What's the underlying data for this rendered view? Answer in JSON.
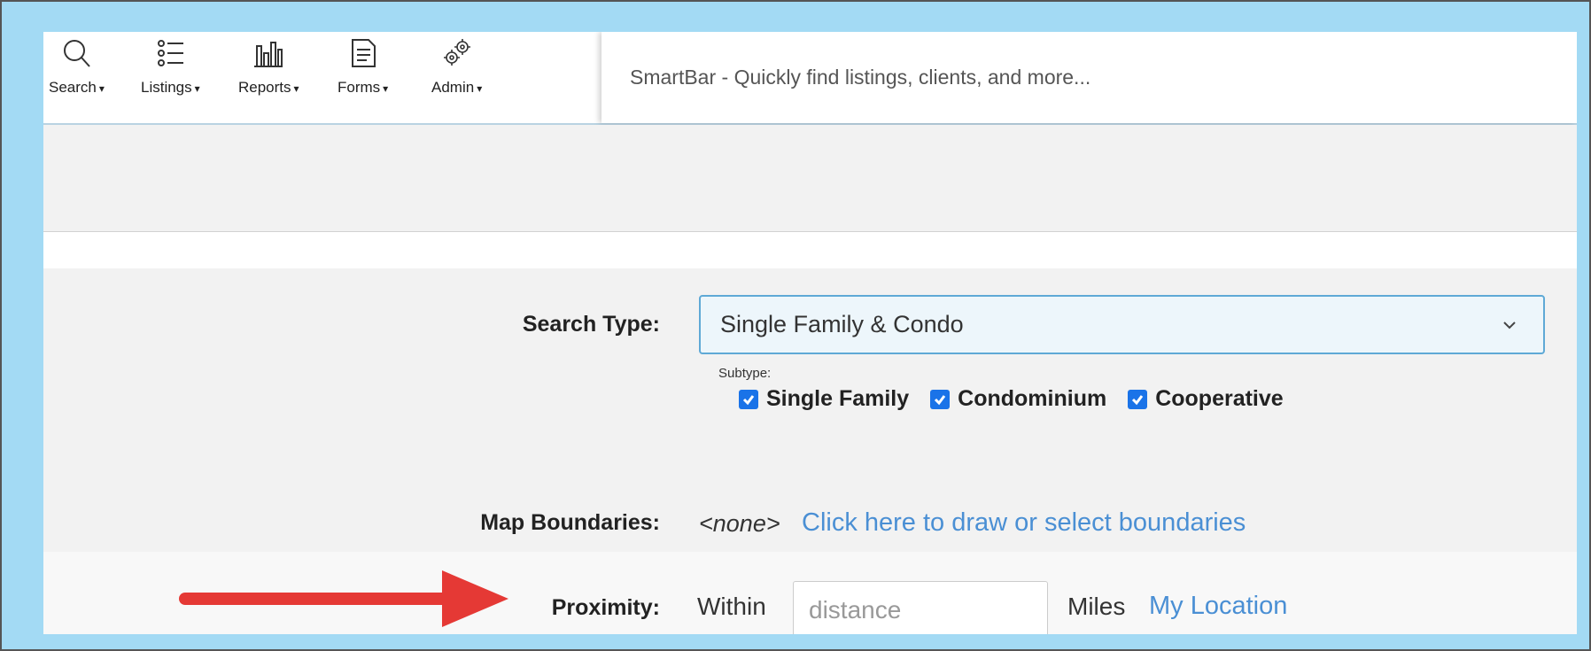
{
  "toolbar": {
    "items": [
      {
        "label": "Search",
        "icon": "search-icon"
      },
      {
        "label": "Listings",
        "icon": "list-icon"
      },
      {
        "label": "Reports",
        "icon": "bar-chart-icon"
      },
      {
        "label": "Forms",
        "icon": "document-icon"
      },
      {
        "label": "Admin",
        "icon": "gears-icon"
      }
    ],
    "caret": "▾"
  },
  "smartbar": {
    "placeholder": "SmartBar - Quickly find listings, clients, and more..."
  },
  "form": {
    "search_type": {
      "label": "Search Type:",
      "selected": "Single Family & Condo"
    },
    "subtype": {
      "label": "Subtype:",
      "options": [
        {
          "label": "Single Family",
          "checked": true
        },
        {
          "label": "Condominium",
          "checked": true
        },
        {
          "label": "Cooperative",
          "checked": true
        }
      ]
    },
    "map_boundaries": {
      "label": "Map Boundaries:",
      "value": "<none>",
      "link": "Click here to draw or select boundaries"
    },
    "proximity": {
      "label": "Proximity:",
      "within": "Within",
      "placeholder": "distance",
      "unit": "Miles",
      "my_location": "My Location"
    }
  },
  "colors": {
    "frame_bg": "#a3daf4",
    "link": "#4a8fd4",
    "checkbox": "#1a73e8",
    "arrow": "#e53935"
  }
}
